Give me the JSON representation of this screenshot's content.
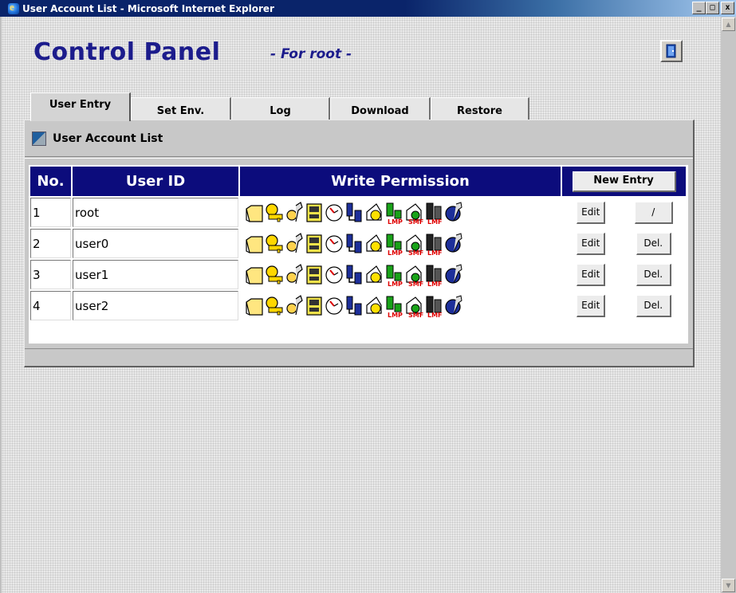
{
  "window": {
    "title": "User Account List - Microsoft Internet Explorer",
    "minimize": "_",
    "maximize": "□",
    "close": "x"
  },
  "header": {
    "title": "Control Panel",
    "subtitle": "- For root -"
  },
  "tabs": [
    {
      "label": "User Entry",
      "active": true
    },
    {
      "label": "Set Env.",
      "active": false
    },
    {
      "label": "Log",
      "active": false
    },
    {
      "label": "Download",
      "active": false
    },
    {
      "label": "Restore",
      "active": false
    }
  ],
  "panel": {
    "heading": "User Account List"
  },
  "table": {
    "columns": [
      "No.",
      "User ID",
      "Write Permission"
    ],
    "new_entry_label": "New Entry",
    "edit_label": "Edit",
    "delete_label": "Del.",
    "root_action_label": "/",
    "rows": [
      {
        "no": "1",
        "user_id": "root"
      },
      {
        "no": "2",
        "user_id": "user0"
      },
      {
        "no": "3",
        "user_id": "user1"
      },
      {
        "no": "4",
        "user_id": "user2"
      }
    ]
  },
  "permission_icons": [
    "folder-icon",
    "key-icon",
    "wrench-icon",
    "server-icon",
    "clock-icon",
    "network-icon",
    "printer-icon",
    "lmp-icon",
    "smf-icon",
    "cmf-icon",
    "globe-wrench-icon"
  ],
  "colors": {
    "accent": "#0c0c7c",
    "title": "#1c1c8c",
    "titlebar": "#0a246a"
  }
}
